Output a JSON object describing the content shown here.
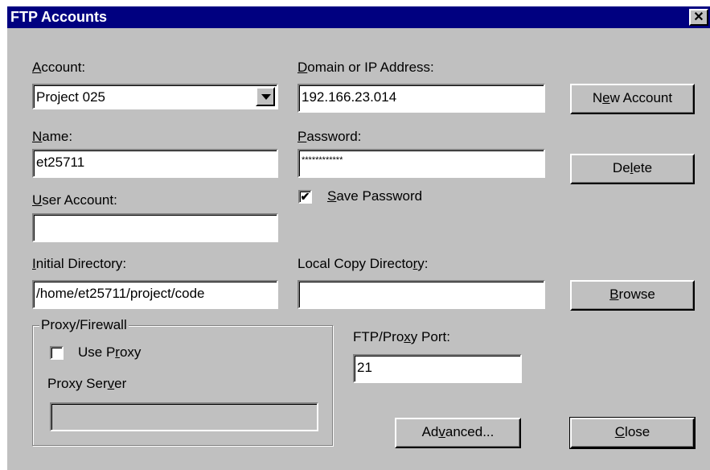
{
  "window": {
    "title": "FTP Accounts",
    "close_glyph": "✕"
  },
  "labels": {
    "account_pre": "",
    "account_key": "A",
    "account_post": "ccount:",
    "domain_pre": "",
    "domain_key": "D",
    "domain_post": "omain or IP Address:",
    "name_pre": "",
    "name_key": "N",
    "name_post": "ame:",
    "password_pre": "",
    "password_key": "P",
    "password_post": "assword:",
    "user_pre": "",
    "user_key": "U",
    "user_post": "ser Account:",
    "initdir_pre": "",
    "initdir_key": "I",
    "initdir_post": "nitial Directory:",
    "localdir_pre": "Local Copy Directo",
    "localdir_key": "r",
    "localdir_post": "y:",
    "port_pre": "FTP/Pro",
    "port_key": "x",
    "port_post": "y Port:",
    "proxy_server_pre": "Proxy Ser",
    "proxy_server_key": "v",
    "proxy_server_post": "er",
    "proxy_group": "Proxy/Firewall"
  },
  "fields": {
    "account": "Project 025",
    "domain": "192.166.23.014",
    "name": "et25711",
    "password": "************",
    "user_account": "",
    "initial_directory": "/home/et25711/project/code",
    "local_copy_directory": "",
    "port": "21",
    "proxy_server": ""
  },
  "checkboxes": {
    "save_password": {
      "pre": "",
      "key": "S",
      "post": "ave Password",
      "checked_glyph": "✔"
    },
    "use_proxy": {
      "pre": "Use P",
      "key": "r",
      "post": "oxy",
      "checked_glyph": ""
    }
  },
  "buttons": {
    "new_account": {
      "pre": "N",
      "key": "e",
      "post": "w Account"
    },
    "delete": {
      "pre": "De",
      "key": "l",
      "post": "ete"
    },
    "browse": {
      "pre": "",
      "key": "B",
      "post": "rowse"
    },
    "advanced": {
      "pre": "Ad",
      "key": "v",
      "post": "anced..."
    },
    "close": {
      "pre": "",
      "key": "C",
      "post": "lose"
    }
  }
}
